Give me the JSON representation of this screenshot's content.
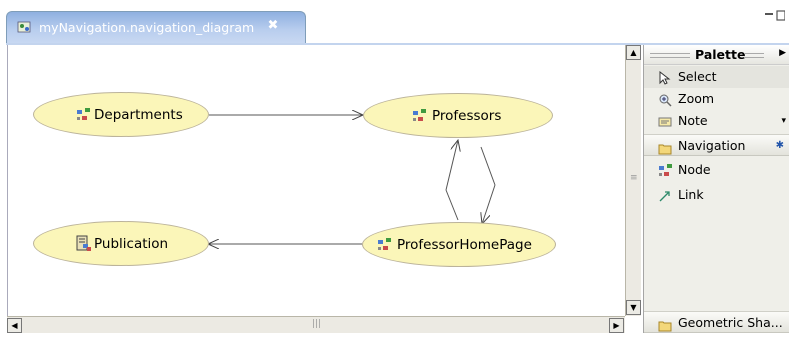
{
  "editor": {
    "tab_title": "myNavigation.navigation_diagram",
    "close_glyph": "✖"
  },
  "diagram": {
    "nodes": [
      {
        "id": "departments",
        "label": "Departments",
        "icon": "node-icon"
      },
      {
        "id": "professors",
        "label": "Professors",
        "icon": "node-icon"
      },
      {
        "id": "publication",
        "label": "Publication",
        "icon": "document-node-icon"
      },
      {
        "id": "professor_home_page",
        "label": "ProfessorHomePage",
        "icon": "node-icon"
      }
    ],
    "links": [
      {
        "from": "Departments",
        "to": "Professors"
      },
      {
        "from": "ProfessorHomePage",
        "to": "Professors"
      },
      {
        "from": "Professors",
        "to": "ProfessorHomePage"
      },
      {
        "from": "ProfessorHomePage",
        "to": "Publication"
      }
    ]
  },
  "palette": {
    "title": "Palette",
    "tools": [
      {
        "label": "Select",
        "icon": "arrow-pointer-icon"
      },
      {
        "label": "Zoom",
        "icon": "zoom-icon"
      },
      {
        "label": "Note",
        "icon": "note-icon"
      }
    ],
    "drawers": [
      {
        "label": "Navigation",
        "icon": "folder-icon"
      },
      {
        "label": "Geometric Sha...",
        "icon": "folder-icon"
      }
    ],
    "navigation_items": [
      {
        "label": "Node",
        "icon": "node-icon"
      },
      {
        "label": "Link",
        "icon": "link-icon"
      }
    ]
  },
  "colors": {
    "node_fill": "#fbf6b9",
    "tab_active": "#9bb7e4",
    "palette_bg": "#efefe9"
  }
}
